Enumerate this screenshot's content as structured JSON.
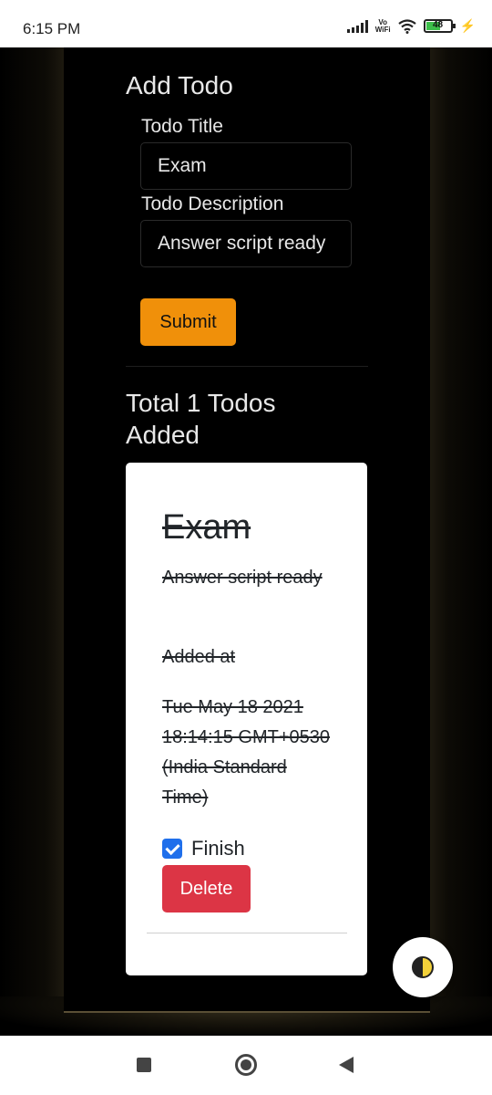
{
  "status_bar": {
    "time": "6:15 PM",
    "network_label_top": "Vo",
    "network_label_bottom": "WiFi",
    "battery_level": "48",
    "icons": [
      "signal-icon",
      "vowifi-icon",
      "wifi-icon",
      "battery-icon",
      "charging-icon"
    ]
  },
  "form": {
    "heading": "Add Todo",
    "title_label": "Todo Title",
    "title_value": "Exam",
    "description_label": "Todo Description",
    "description_value": "Answer script ready",
    "submit_label": "Submit"
  },
  "list": {
    "heading": "Total 1 Todos Added",
    "todos": [
      {
        "title": "Exam",
        "description": "Answer script ready",
        "added_label": "Added at",
        "added_value": "Tue May 18 2021 18:14:15 GMT+0530 (India Standard Time)",
        "finish_label": "Finish",
        "finished": true,
        "delete_label": "Delete"
      }
    ]
  },
  "colors": {
    "submit_button": "#f0900a",
    "delete_button": "#dc3545",
    "checkbox_checked": "#1f6feb",
    "page_background": "#000000",
    "card_background": "#ffffff"
  },
  "theme_toggle": {
    "icon": "contrast-icon"
  },
  "nav_bar": {
    "icons": [
      "recent-apps-icon",
      "home-icon",
      "back-icon"
    ]
  }
}
